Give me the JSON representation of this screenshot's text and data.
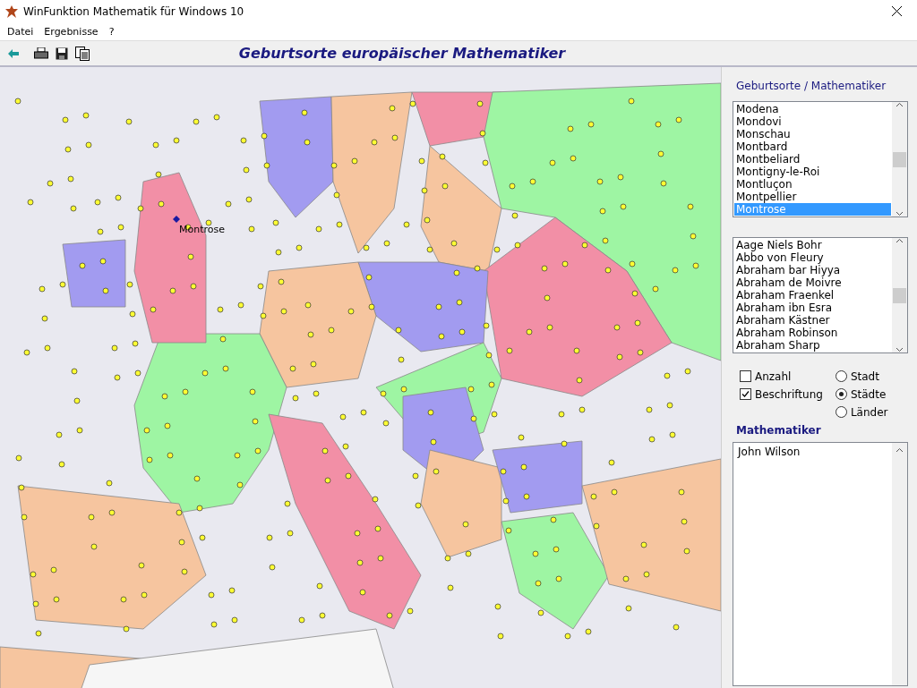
{
  "window": {
    "title": "WinFunktion Mathematik für Windows 10"
  },
  "menu": [
    "Datei",
    "Ergebnisse",
    "?"
  ],
  "page_title": "Geburtsorte europäischer Mathematiker",
  "map": {
    "label": "Montrose"
  },
  "panel": {
    "heading": "Geburtsorte / Mathematiker",
    "places": [
      {
        "label": "Modena",
        "selected": false
      },
      {
        "label": "Mondovi",
        "selected": false
      },
      {
        "label": "Monschau",
        "selected": false
      },
      {
        "label": "Montbard",
        "selected": false
      },
      {
        "label": "Montbeliard",
        "selected": false
      },
      {
        "label": "Montigny-le-Roi",
        "selected": false
      },
      {
        "label": "Montluçon",
        "selected": false
      },
      {
        "label": "Montpellier",
        "selected": false
      },
      {
        "label": "Montrose",
        "selected": true
      }
    ],
    "mathematicians": [
      "Aage Niels Bohr",
      "Abbo von Fleury",
      "Abraham bar Hiyya",
      "Abraham de Moivre",
      "Abraham Fraenkel",
      "Abraham ibn Esra",
      "Abraham Kästner",
      "Abraham Robinson",
      "Abraham Sharp"
    ],
    "checkboxes": [
      {
        "label": "Anzahl",
        "checked": false
      },
      {
        "label": "Beschriftung",
        "checked": true
      }
    ],
    "radios": [
      {
        "label": "Stadt",
        "selected": false
      },
      {
        "label": "Städte",
        "selected": true
      },
      {
        "label": "Länder",
        "selected": false
      }
    ],
    "result_heading": "Mathematiker",
    "results": [
      "John Wilson"
    ]
  }
}
